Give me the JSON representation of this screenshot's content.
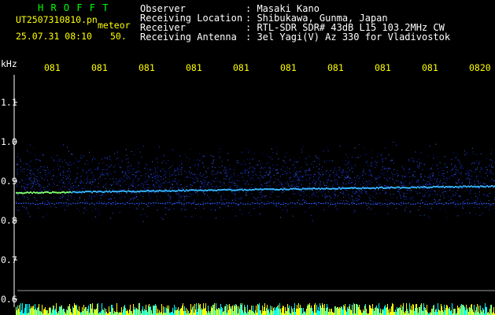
{
  "header": {
    "station": "H R O F F T",
    "filename": "UT2507310810.pn",
    "meteor_label": "meteor",
    "datetime": "25.07.31 08:10",
    "count": "50.",
    "info": [
      {
        "label": "Observer",
        "value": ": Masaki Kano"
      },
      {
        "label": "Receiving Location",
        "value": ": Shibukawa, Gunma, Japan"
      },
      {
        "label": "Receiver",
        "value": ": RTL-SDR SDR# 43dB L15 103.2MHz CW"
      },
      {
        "label": "Receiving Antenna",
        "value": ": 3el Yagi(V) Az 330 for Vladivostok"
      }
    ]
  },
  "y_axis": {
    "unit": "kHz",
    "ticks": [
      "1.1",
      "1.0",
      "0.9",
      "0.8",
      "0.7",
      "0.6"
    ]
  },
  "x_axis": {
    "ticks": [
      "081",
      "081",
      "081",
      "081",
      "081",
      "081",
      "081",
      "081",
      "081",
      "0820"
    ]
  },
  "colors": {
    "station": "#00ff00",
    "timestamp": "#ffff00",
    "info": "#ffffff",
    "axis": "#ffffff",
    "noise_band": "#1e2fd6",
    "echo_line": "#35b6ff",
    "activity_bar": "#ffff00",
    "activity_cyan": "#00ffff"
  }
}
